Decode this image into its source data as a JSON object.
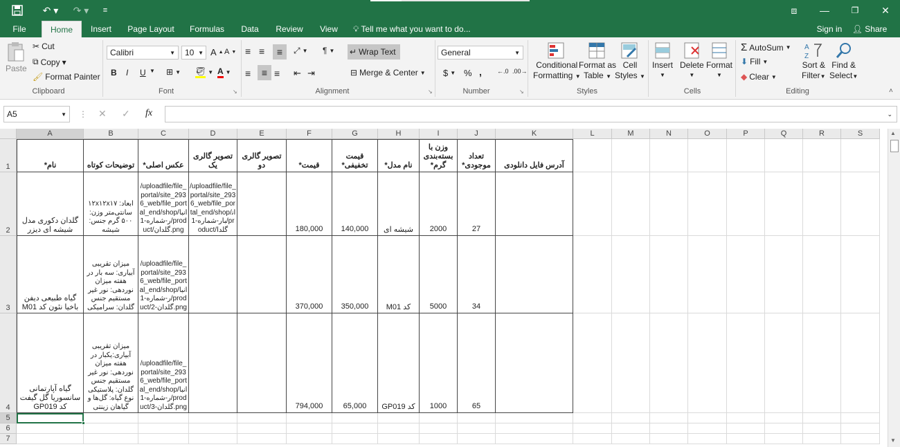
{
  "window": {
    "title_hint": ""
  },
  "tabs": {
    "file": "File",
    "home": "Home",
    "insert": "Insert",
    "page_layout": "Page Layout",
    "formulas": "Formulas",
    "data": "Data",
    "review": "Review",
    "view": "View",
    "tell_me": "Tell me what you want to do...",
    "sign_in": "Sign in",
    "share": "Share"
  },
  "clipboard": {
    "paste": "Paste",
    "cut": "Cut",
    "copy": "Copy",
    "format_painter": "Format Painter",
    "label": "Clipboard"
  },
  "font": {
    "name": "Calibri",
    "size": "10",
    "label": "Font",
    "bold": "B",
    "italic": "I",
    "underline": "U"
  },
  "alignment": {
    "wrap_text": "Wrap Text",
    "merge_center": "Merge & Center",
    "label": "Alignment"
  },
  "number": {
    "format": "General",
    "currency": "$",
    "percent": "%",
    "comma": ",",
    "label": "Number"
  },
  "styles": {
    "conditional": "Conditional",
    "formatting": "Formatting",
    "format_as": "Format as",
    "table": "Table",
    "cell": "Cell",
    "cell_styles": "Styles",
    "label": "Styles"
  },
  "cells": {
    "insert": "Insert",
    "delete": "Delete",
    "format": "Format",
    "label": "Cells"
  },
  "editing": {
    "autosum": "AutoSum",
    "fill": "Fill",
    "clear": "Clear",
    "sort": "Sort &",
    "filter": "Filter",
    "find": "Find &",
    "select": "Select",
    "label": "Editing"
  },
  "formula": {
    "name_box": "A5",
    "fx": "fx",
    "content": ""
  },
  "columns": [
    "A",
    "B",
    "C",
    "D",
    "E",
    "F",
    "G",
    "H",
    "I",
    "J",
    "K",
    "L",
    "M",
    "N",
    "O",
    "P",
    "Q",
    "R",
    "S"
  ],
  "rows": [
    "1",
    "2",
    "3",
    "4",
    "5",
    "6",
    "7"
  ],
  "header_row": [
    "نام*",
    "توضیحات کوتاه",
    "عکس اصلی*",
    "تصویر گالری یک",
    "تصویر گالری دو",
    "قیمت*",
    "قیمت تخفیفی*",
    "نام مدل*",
    "وزن با بسته‌بندی گرم*",
    "تعداد موجودی*",
    "آدرس فایل دانلودی"
  ],
  "data_rows": [
    {
      "a": "گلدان دکوری مدل شیشه ای دیزر",
      "b": "ابعاد: ۱۲x۱۲x۱۷ سانتی‌متر وزن: ۵۰۰ گرم جنس: شیشه",
      "c": "/uploadfile/file_portal/site_2936_web/file_portal_end/shop/انبار-شماره-1/product/گلدان.png",
      "d": "/uploadfile/file_portal/site_2936_web/file_portal_end/shop/انبار-شماره-1/product/گلدا",
      "e": "",
      "f": "180,000",
      "g": "140,000",
      "h": "شیشه ای",
      "i": "2000",
      "j": "27",
      "k": ""
    },
    {
      "a": "گیاه طبیعی دیفن باخیا نئون کد M01",
      "b": "میزان تقریبی آبیاری: سه بار در هفته میزان نوردهی: نور غیر مستقیم جنس گلدان: سرامیکی",
      "c": "/uploadfile/file_portal/site_2936_web/file_portal_end/shop/انبار-شماره-1/product/گلدان-2.png",
      "d": "",
      "e": "",
      "f": "370,000",
      "g": "350,000",
      "h": "کد M01",
      "i": "5000",
      "j": "34",
      "k": ""
    },
    {
      "a": "گیاه آپارتمانی سانسوریا گل گیفت کد GP019",
      "b": "میزان تقریبی آبیاری:یکبار در هفته میزان نوردهی: نور غیر مستقیم جنس گلدان: پلاستیکی نوع گیاه: گل‌ها و گیاهان زینتی",
      "c": "/uploadfile/file_portal/site_2936_web/file_portal_end/shop/انبار-شماره-1/product/گلدان-3.png",
      "d": "",
      "e": "",
      "f": "794,000",
      "g": "65,000",
      "h": "کد GP019",
      "i": "1000",
      "j": "65",
      "k": ""
    }
  ],
  "colors": {
    "accent": "#217346"
  }
}
